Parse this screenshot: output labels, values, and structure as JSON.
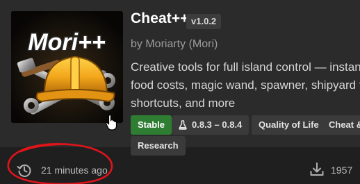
{
  "mod": {
    "thumbnail_text": "Mori++",
    "title": "Cheat++",
    "version": "v1.0.2",
    "author": "by Moriarty (Mori)",
    "description_lines": [
      "Creative tools for full island control — instant bu",
      "food costs, magic wand, spawner, shipyard tab,",
      "shortcuts, and more"
    ]
  },
  "tags": {
    "stable": "Stable",
    "game_version": "0.8.3 – 0.8.4",
    "category_1": "Quality of Life",
    "category_2": "Cheat &",
    "category_3": "Research"
  },
  "footer": {
    "updated": "21 minutes ago",
    "downloads": "1957"
  },
  "colors": {
    "card_bg": "#2b2b2b",
    "footer_bg": "#1f1f1f",
    "stable_green": "#2e7d32",
    "annotation_red": "#e0141b"
  },
  "icons": {
    "updated": "history-icon",
    "downloads": "download-icon",
    "game_version": "flask-icon",
    "cursor": "hand-pointer-icon"
  }
}
